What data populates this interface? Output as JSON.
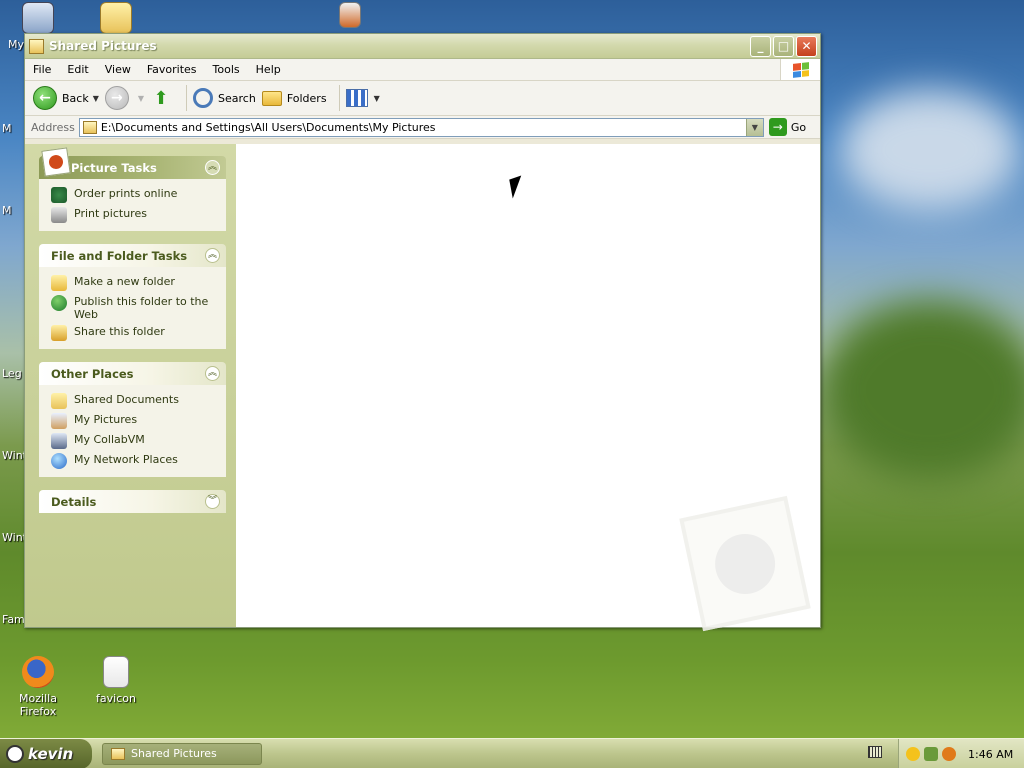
{
  "desktop": {
    "icons": [
      {
        "label": "My"
      },
      {
        "label": "Mozilla Firefox"
      },
      {
        "label": "favicon"
      }
    ],
    "edge_labels": [
      "M",
      "M",
      "Leg",
      "Wint",
      "Wint",
      "Fam"
    ]
  },
  "window": {
    "title": "Shared Pictures",
    "buttons": {
      "minimize": "_",
      "maximize": "□",
      "close": "✕"
    },
    "menu": [
      "File",
      "Edit",
      "View",
      "Favorites",
      "Tools",
      "Help"
    ],
    "toolbar": {
      "back": "Back",
      "search": "Search",
      "folders": "Folders"
    },
    "address": {
      "label": "Address",
      "value": "E:\\Documents and Settings\\All Users\\Documents\\My Pictures",
      "go": "Go"
    },
    "taskpane": {
      "picture_tasks": {
        "title": "Picture Tasks",
        "items": [
          "Order prints online",
          "Print pictures"
        ]
      },
      "file_folder_tasks": {
        "title": "File and Folder Tasks",
        "items": [
          "Make a new folder",
          "Publish this folder to the Web",
          "Share this folder"
        ]
      },
      "other_places": {
        "title": "Other Places",
        "items": [
          "Shared Documents",
          "My Pictures",
          "My CollabVM",
          "My Network Places"
        ]
      },
      "details": {
        "title": "Details"
      }
    }
  },
  "taskbar": {
    "start_label": "kevin",
    "open_window": "Shared Pictures",
    "clock": "1:46 AM"
  },
  "colors": {
    "titlebar": "#c4cc96",
    "taskpane": "#c0c98d",
    "accent_green": "#2f9a1e"
  }
}
